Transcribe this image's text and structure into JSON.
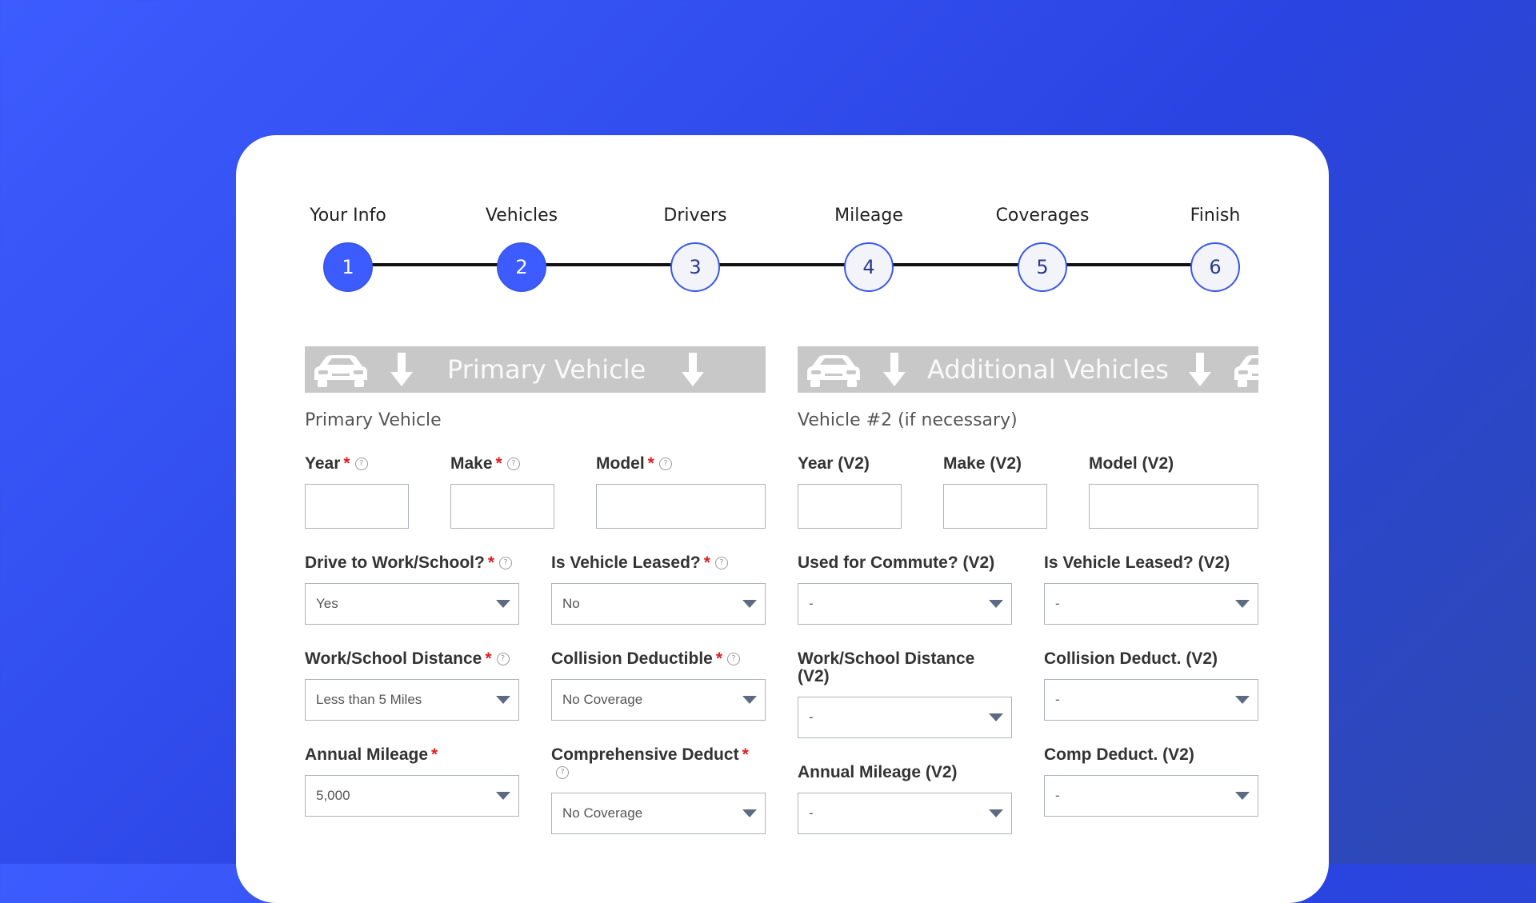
{
  "stepper": {
    "steps": [
      {
        "label": "Your Info",
        "number": "1",
        "state": "done"
      },
      {
        "label": "Vehicles",
        "number": "2",
        "state": "current"
      },
      {
        "label": "Drivers",
        "number": "3",
        "state": "pending"
      },
      {
        "label": "Mileage",
        "number": "4",
        "state": "pending"
      },
      {
        "label": "Coverages",
        "number": "5",
        "state": "pending"
      },
      {
        "label": "Finish",
        "number": "6",
        "state": "pending"
      }
    ]
  },
  "primary": {
    "banner_title": "Primary Vehicle",
    "section_title": "Primary Vehicle",
    "year_label": "Year",
    "make_label": "Make",
    "model_label": "Model",
    "drive_label": "Drive to Work/School?",
    "drive_value": "Yes",
    "leased_label": "Is Vehicle Leased?",
    "leased_value": "No",
    "distance_label": "Work/School Distance",
    "distance_value": "Less than 5 Miles",
    "collision_label": "Collision Deductible",
    "collision_value": "No Coverage",
    "mileage_label": "Annual Mileage",
    "mileage_value": "5,000",
    "comp_label": "Comprehensive Deduct",
    "comp_value": "No Coverage"
  },
  "additional": {
    "banner_title": "Additional Vehicles",
    "section_title": "Vehicle #2 (if necessary)",
    "year_label": "Year (V2)",
    "make_label": "Make (V2)",
    "model_label": "Model (V2)",
    "commute_label": "Used for Commute? (V2)",
    "commute_value": "-",
    "leased_label": "Is Vehicle Leased? (V2)",
    "leased_value": "-",
    "distance_label": "Work/School Distance (V2)",
    "distance_value": "-",
    "collision_label": "Collision Deduct. (V2)",
    "collision_value": "-",
    "mileage_label": "Annual Mileage (V2)",
    "mileage_value": "-",
    "comp_label": "Comp Deduct. (V2)",
    "comp_value": "-"
  },
  "symbols": {
    "required": "*",
    "help": "?"
  },
  "icons": {
    "car": "car-icon",
    "arrow": "arrow-down-icon",
    "help": "help-icon",
    "caret": "chevron-down-icon"
  },
  "colors": {
    "accent": "#3d5cff",
    "required": "#e02020",
    "banner": "#c8c8c8"
  }
}
